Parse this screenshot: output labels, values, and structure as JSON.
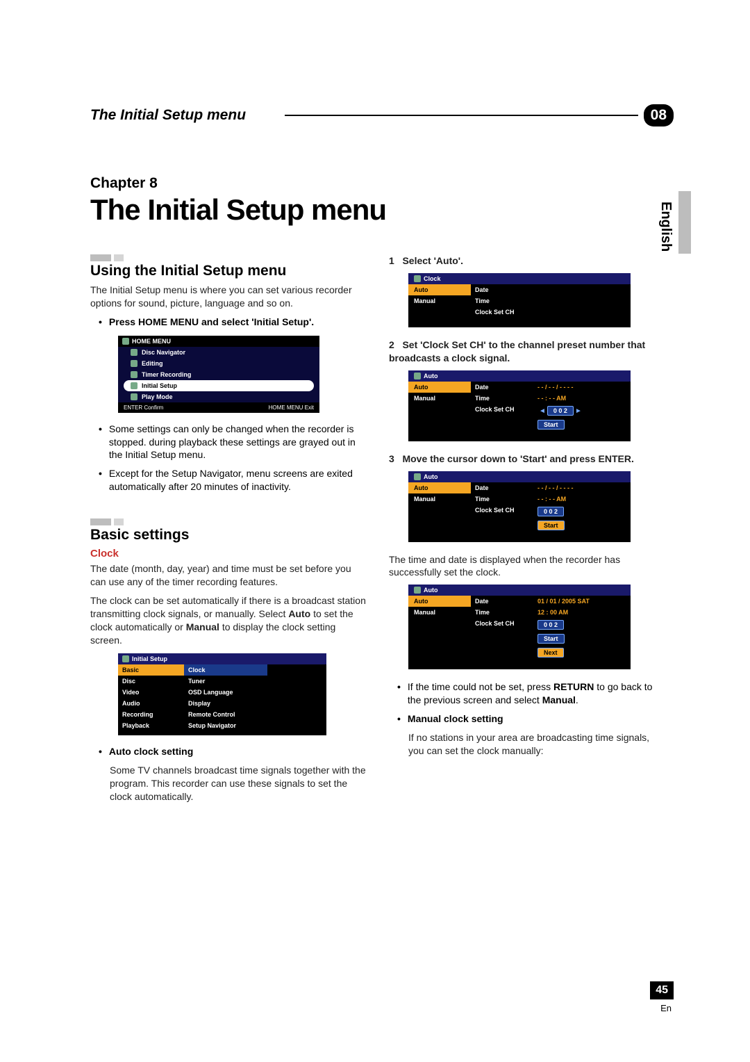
{
  "header": {
    "title": "The Initial Setup menu",
    "badge": "08"
  },
  "side": {
    "language": "English"
  },
  "chapter": {
    "label": "Chapter 8",
    "title": "The Initial Setup menu"
  },
  "left": {
    "sec1_title": "Using the Initial Setup menu",
    "sec1_body": "The Initial Setup menu is where you can set various recorder options for sound, picture, language and so on.",
    "sec1_bullet_intro": "Press HOME MENU and select 'Initial Setup'.",
    "home_menu": {
      "title": "HOME MENU",
      "items": [
        "Disc Navigator",
        "Editing",
        "Timer Recording",
        "Initial Setup",
        "Play Mode"
      ],
      "footer_left": "ENTER  Confirm",
      "footer_right": "HOME MENU  Exit"
    },
    "note1": "Some settings can only be changed when the recorder is stopped. during playback these settings are grayed out in the Initial Setup menu.",
    "note2": "Except for the Setup Navigator, menu screens are exited automatically after 20 minutes of inactivity.",
    "sec2_title": "Basic settings",
    "clock_h": "Clock",
    "clock_p1": "The date (month, day, year) and time must be set before you can use any of the timer recording features.",
    "clock_p2_a": "The clock can be set automatically if there is a broadcast station transmitting clock signals, or manually. Select ",
    "clock_p2_auto": "Auto",
    "clock_p2_b": " to set the clock automatically or ",
    "clock_p2_manual": "Manual",
    "clock_p2_c": " to display the clock setting screen.",
    "initial_setup_menu": {
      "title": "Initial Setup",
      "left_items": [
        "Basic",
        "Disc",
        "Video",
        "Audio",
        "Recording",
        "Playback"
      ],
      "right_items": [
        "Clock",
        "Tuner",
        "OSD Language",
        "Display",
        "Remote Control",
        "Setup Navigator"
      ]
    },
    "auto_h": "Auto clock setting",
    "auto_p": "Some TV channels broadcast time signals together with the program. This recorder can use these signals to set the clock automatically."
  },
  "right": {
    "step1": "Select 'Auto'.",
    "clock_screen_1": {
      "title": "Clock",
      "left": [
        "Auto",
        "Manual"
      ],
      "labels": [
        "Date",
        "Time",
        "Clock Set CH"
      ]
    },
    "step2": "Set 'Clock Set CH' to the channel preset number that broadcasts a clock signal.",
    "clock_screen_2": {
      "title": "Auto",
      "left": [
        "Auto",
        "Manual"
      ],
      "labels": [
        "Date",
        "Time",
        "Clock Set CH"
      ],
      "vals": [
        "- - / - - / - - - -",
        "- - : - -  AM",
        "0 0 2"
      ],
      "start": "Start"
    },
    "step3": "Move the cursor down to 'Start' and press ENTER.",
    "clock_screen_3": {
      "title": "Auto",
      "left": [
        "Auto",
        "Manual"
      ],
      "labels": [
        "Date",
        "Time",
        "Clock Set CH"
      ],
      "vals": [
        "- - / - - / - - - -",
        "- - : - -  AM",
        "0 0 2"
      ],
      "start": "Start"
    },
    "after_p": "The time and date is displayed when the recorder has successfully set the clock.",
    "clock_screen_4": {
      "title": "Auto",
      "left": [
        "Auto",
        "Manual"
      ],
      "labels": [
        "Date",
        "Time",
        "Clock Set CH"
      ],
      "vals": [
        "01  /  01  /  2005  SAT",
        "12 : 00  AM",
        "0 0 2"
      ],
      "start": "Start",
      "next": "Next"
    },
    "note_a": "If the time could not be set, press ",
    "note_return": "RETURN",
    "note_b": " to go back to the previous screen and select ",
    "note_manual": "Manual",
    "note_c": ".",
    "manual_h": "Manual clock setting",
    "manual_p": "If no stations in your area are broadcasting time signals, you can set the clock manually:"
  },
  "footer": {
    "page": "45",
    "lang": "En"
  }
}
